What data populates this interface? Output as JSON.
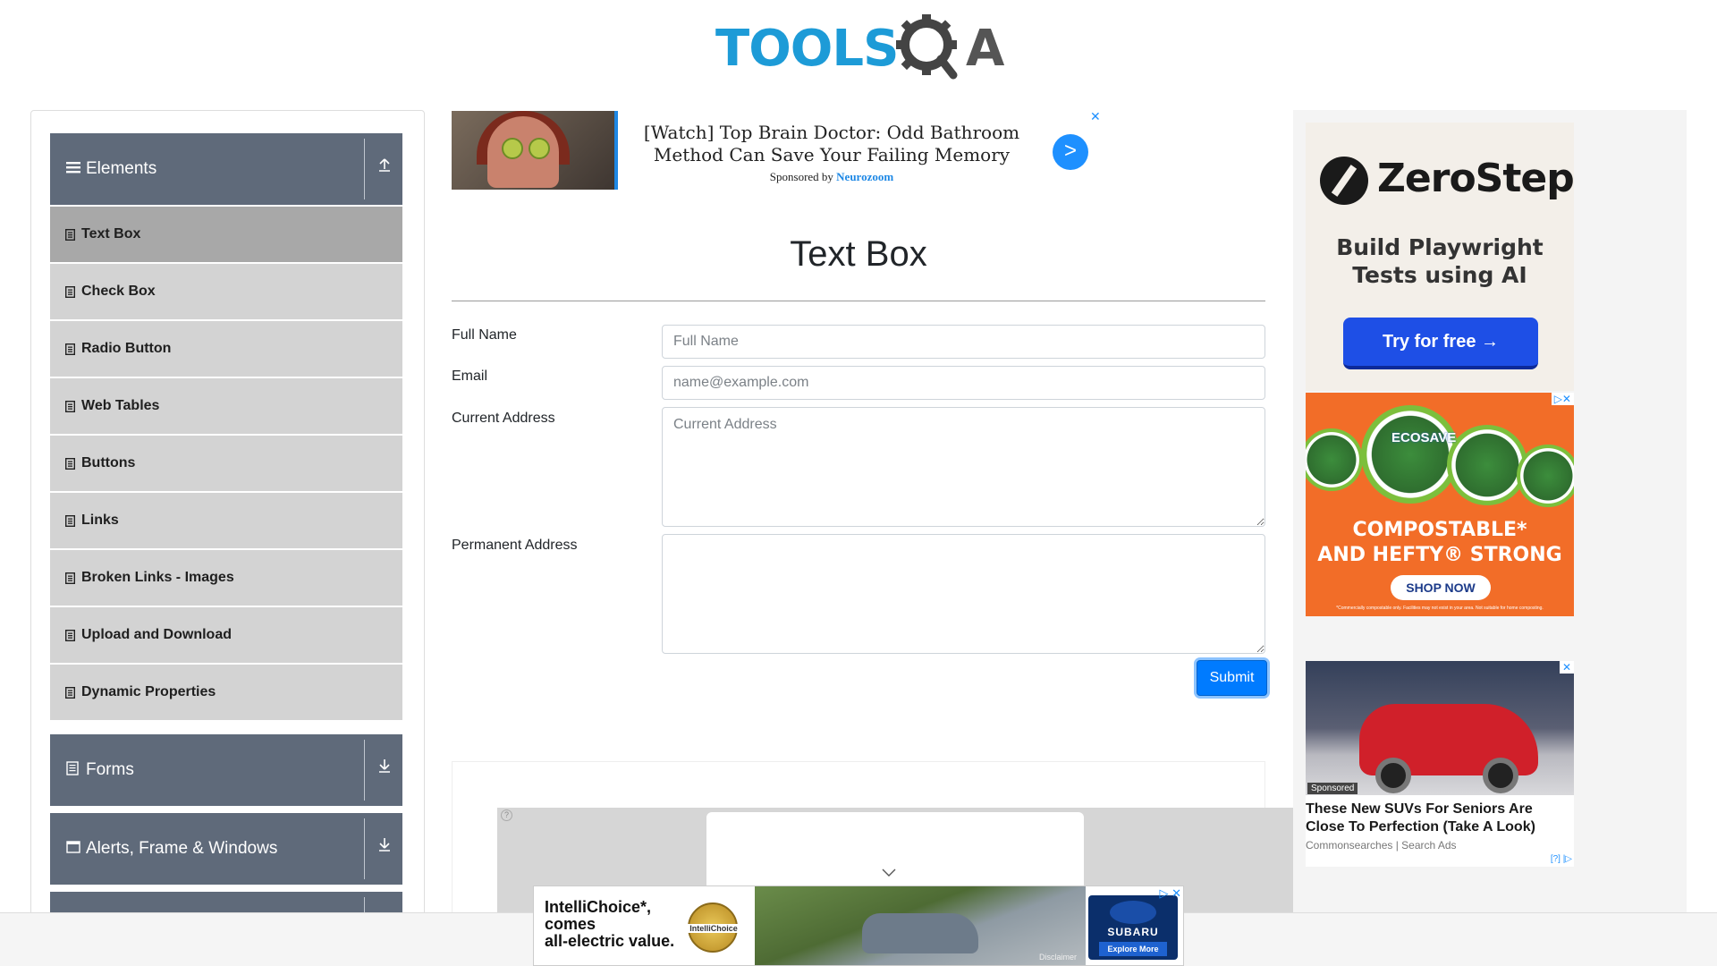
{
  "header": {
    "logo_text_left": "TOOLS",
    "logo_text_right": "A"
  },
  "sidebar": {
    "groups": [
      {
        "title": "Elements",
        "icon": "menu-icon",
        "arrow": "collapse-icon",
        "items": [
          {
            "label": "Text Box",
            "active": true
          },
          {
            "label": "Check Box"
          },
          {
            "label": "Radio Button"
          },
          {
            "label": "Web Tables"
          },
          {
            "label": "Buttons"
          },
          {
            "label": "Links"
          },
          {
            "label": "Broken Links - Images"
          },
          {
            "label": "Upload and Download"
          },
          {
            "label": "Dynamic Properties"
          }
        ]
      },
      {
        "title": "Forms",
        "icon": "document-icon",
        "arrow": "expand-icon"
      },
      {
        "title": "Alerts, Frame & Windows",
        "icon": "window-icon",
        "arrow": "expand-icon"
      }
    ]
  },
  "top_ad": {
    "headline": "[Watch] Top Brain Doctor: Odd Bathroom Method Can Save Your Failing Memory",
    "sponsored_prefix": "Sponsored by",
    "sponsor": "Neurozoom",
    "go_label": ">",
    "close_label": "✕"
  },
  "main": {
    "title": "Text Box",
    "fields": {
      "full_name": {
        "label": "Full Name",
        "placeholder": "Full Name",
        "value": ""
      },
      "email": {
        "label": "Email",
        "placeholder": "name@example.com",
        "value": ""
      },
      "current_address": {
        "label": "Current Address",
        "placeholder": "Current Address",
        "value": ""
      },
      "permanent_address": {
        "label": "Permanent Address",
        "placeholder": "",
        "value": ""
      }
    },
    "submit_label": "Submit",
    "accent_color": "#007bff"
  },
  "right_ads": {
    "zerostep": {
      "name": "ZeroStep",
      "tagline": "Build Playwright Tests using AI",
      "cta": "Try for free →"
    },
    "hefty": {
      "headline_1": "COMPOSTABLE*",
      "headline_2": "AND HEFTY® STRONG",
      "cta": "SHOP NOW",
      "fine_print": "*Commercially compostable only. Facilities may not exist in your area. Not suitable for home composting.",
      "brand_1": "Hefty",
      "brand_2": "ECOSAVE"
    },
    "suv": {
      "badge": "Sponsored",
      "headline": "These New SUVs For Seniors Are Close To Perfection (Take A Look)",
      "source": "Commonsearches | Search Ads",
      "adchoices": "[?] |▷"
    }
  },
  "bottom_ad": {
    "text_line_1": "IntelliChoice*,",
    "text_line_2": "comes",
    "text_line_3": "all-electric value.",
    "badge": "IntelliChoice",
    "disclaimer": "Disclaimer",
    "brand": "SUBARU",
    "cta": "Explore More"
  }
}
